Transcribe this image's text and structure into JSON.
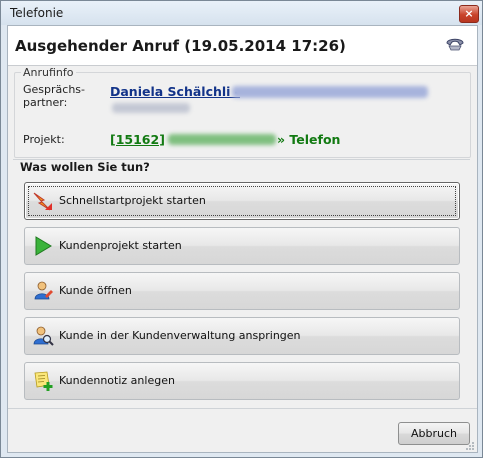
{
  "window": {
    "title": "Telefonie",
    "close_glyph": "×"
  },
  "header": {
    "title": "Ausgehender Anruf (19.05.2014 17:26)",
    "icon": "phone-handset-icon"
  },
  "anrufinfo": {
    "group_label": "Anrufinfo",
    "partner_label": "Gesprächs-\npartner:",
    "partner_name": "Daniela Schälchli -",
    "project_label": "Projekt:",
    "project_number": "[15162]",
    "project_tail": "» Telefon"
  },
  "question": "Was wollen Sie tun?",
  "actions": [
    {
      "label": "Schnellstartprojekt starten",
      "icon": "lightning-arrow-icon",
      "focused": true
    },
    {
      "label": "Kundenprojekt starten",
      "icon": "play-icon",
      "focused": false
    },
    {
      "label": "Kunde öffnen",
      "icon": "user-edit-icon",
      "focused": false
    },
    {
      "label": "Kunde in der Kundenverwaltung anspringen",
      "icon": "user-search-icon",
      "focused": false
    },
    {
      "label": "Kundennotiz anlegen",
      "icon": "note-add-icon",
      "focused": false
    }
  ],
  "footer": {
    "cancel_label": "Abbruch"
  },
  "colors": {
    "link_blue": "#123389",
    "project_green": "#127a12",
    "blur_blue": "#a7b3dc",
    "blur_green": "#7fbf7f"
  }
}
